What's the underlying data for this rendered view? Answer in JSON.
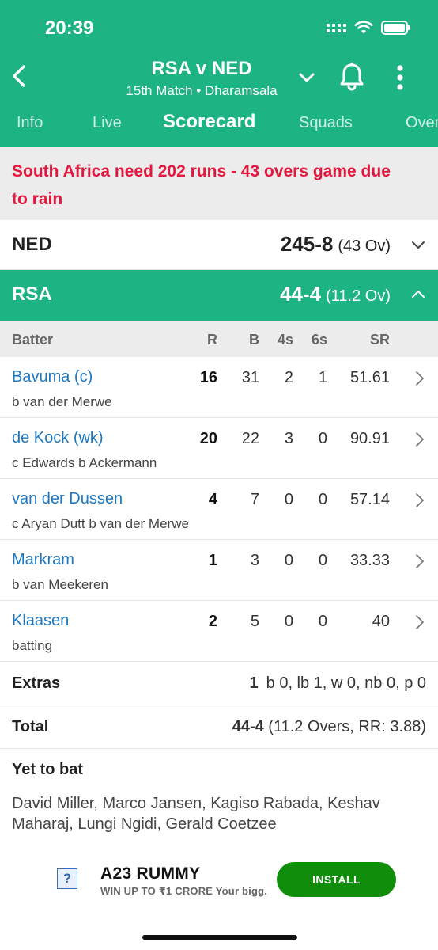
{
  "status_bar": {
    "time": "20:39"
  },
  "header": {
    "title": "RSA v NED",
    "subtitle": "15th Match • Dharamsala"
  },
  "tabs": [
    {
      "label": "Info",
      "active": false
    },
    {
      "label": "Live",
      "active": false
    },
    {
      "label": "Scorecard",
      "active": true
    },
    {
      "label": "Squads",
      "active": false
    },
    {
      "label": "Overs",
      "active": false
    }
  ],
  "notice": {
    "line1": "South Africa need 202 runs - 43 overs game due",
    "line2": "to rain"
  },
  "innings": [
    {
      "team": "NED",
      "score": "245-8",
      "overs": "(43 Ov)",
      "expanded": false
    },
    {
      "team": "RSA",
      "score": "44-4",
      "overs": "(11.2 Ov)",
      "expanded": true
    }
  ],
  "batting_table": {
    "headers": {
      "batter": "Batter",
      "r": "R",
      "b": "B",
      "fours": "4s",
      "sixes": "6s",
      "sr": "SR"
    },
    "rows": [
      {
        "name": "Bavuma (c)",
        "dismissal": "b van der Merwe",
        "r": "16",
        "b": "31",
        "fours": "2",
        "sixes": "1",
        "sr": "51.61"
      },
      {
        "name": "de Kock (wk)",
        "dismissal": "c Edwards b Ackermann",
        "r": "20",
        "b": "22",
        "fours": "3",
        "sixes": "0",
        "sr": "90.91"
      },
      {
        "name": "van der Dussen",
        "dismissal": "c Aryan Dutt b van der Merwe",
        "r": "4",
        "b": "7",
        "fours": "0",
        "sixes": "0",
        "sr": "57.14"
      },
      {
        "name": "Markram",
        "dismissal": "b van Meekeren",
        "r": "1",
        "b": "3",
        "fours": "0",
        "sixes": "0",
        "sr": "33.33"
      },
      {
        "name": "Klaasen",
        "dismissal": "batting",
        "r": "2",
        "b": "5",
        "fours": "0",
        "sixes": "0",
        "sr": "40"
      }
    ]
  },
  "extras": {
    "label": "Extras",
    "total": "1",
    "detail": "b 0, lb 1, w 0, nb 0, p 0"
  },
  "total": {
    "label": "Total",
    "score": "44-4",
    "detail": "(11.2 Overs, RR: 3.88)"
  },
  "yet_to_bat": {
    "label": "Yet to bat",
    "players": "David Miller, Marco Jansen, Kagiso Rabada, Keshav Maharaj, Lungi Ngidi, Gerald Coetzee"
  },
  "ad": {
    "title": "A23 RUMMY",
    "subtitle": "WIN UP TO ₹1 CRORE Your bigg.",
    "button": "INSTALL"
  },
  "colors": {
    "brand_green": "#1db383",
    "alert_red": "#e5173f",
    "link_blue": "#1d78c1",
    "install_green": "#118d0c"
  },
  "icons": [
    "back-chevron-icon",
    "dropdown-chevron-icon",
    "bell-icon",
    "more-vertical-icon",
    "signal-icon",
    "wifi-icon",
    "battery-icon"
  ]
}
